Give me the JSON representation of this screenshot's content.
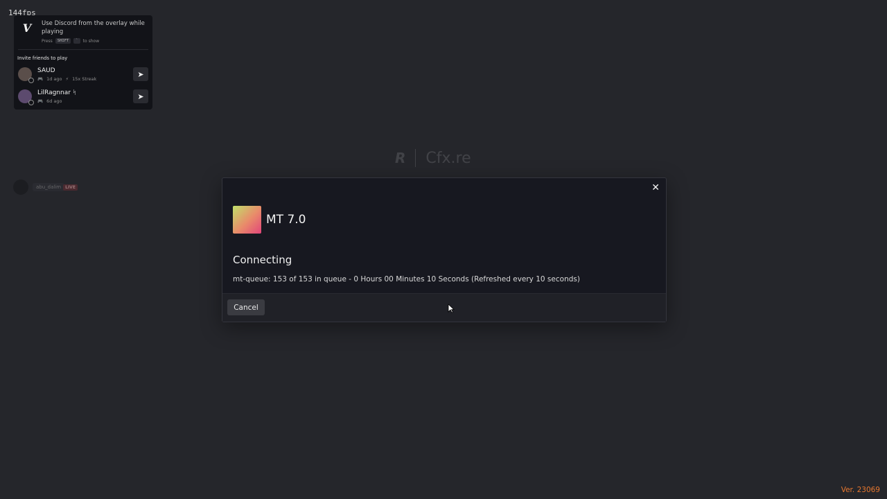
{
  "fps": "144fps",
  "overlay": {
    "title": "Use Discord from the overlay while playing",
    "hint_press": "Press",
    "hint_key1": "SHIFT",
    "hint_key2": "`",
    "hint_show": "to show",
    "invite_label": "Invite friends to play",
    "friends": [
      {
        "name": "SAUD",
        "time": "1d ago",
        "streak": "15x Streak",
        "send_icon": "send-arrow-icon"
      },
      {
        "name": "LilRagnnar ᛋ",
        "time": "6d ago",
        "streak": "",
        "send_icon": "send-arrow-icon"
      }
    ]
  },
  "live": {
    "name": "abu_dalim",
    "badge": "LIVE"
  },
  "background": {
    "brand_cfx": "Cfx.re",
    "sub": ""
  },
  "modal": {
    "server_name": "MT 7.0",
    "status_title": "Connecting",
    "status_message": "mt-queue: 153 of 153 in queue - 0 Hours 00 Minutes 10 Seconds (Refreshed every 10 seconds)",
    "close_icon": "close-icon",
    "cancel_label": "Cancel",
    "icon_gradient": [
      "#c0e06a",
      "#e98a6a",
      "#e2457a"
    ]
  },
  "version": "Ver. 23069",
  "colors": {
    "accent_version": "#e8772e",
    "background": "#25262b",
    "modal": "#171820"
  }
}
